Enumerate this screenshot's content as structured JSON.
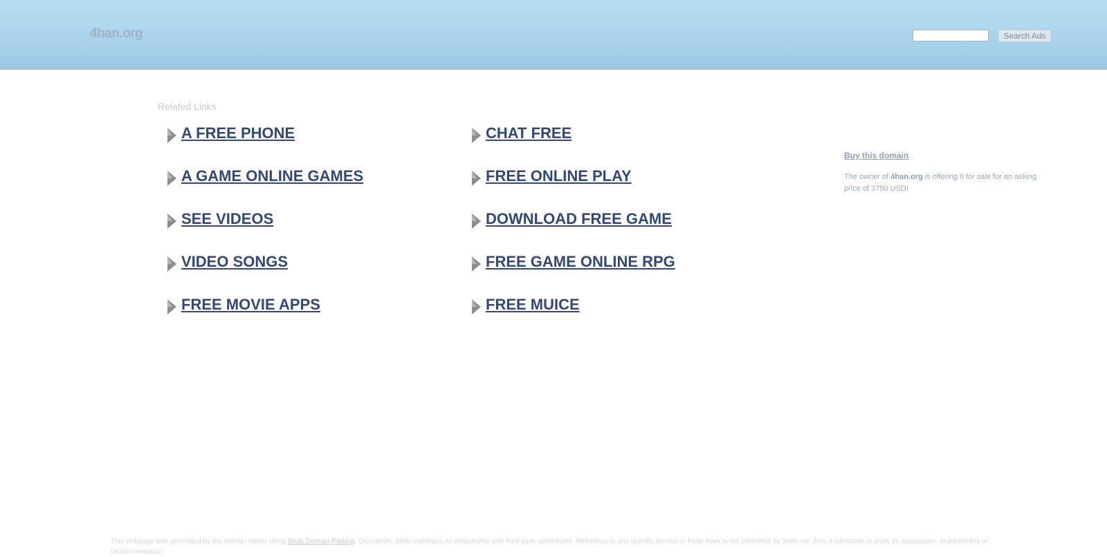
{
  "header": {
    "site_title": "4han.org",
    "search": {
      "placeholder": "",
      "value": ""
    },
    "search_button_label": "Search Ads"
  },
  "related": {
    "title": "Related Links",
    "left_links": [
      "A FREE PHONE",
      "A GAME ONLINE GAMES",
      "SEE VIDEOS",
      "VIDEO SONGS",
      "FREE MOVIE APPS"
    ],
    "right_links": [
      "CHAT FREE",
      "FREE ONLINE PLAY",
      "DOWNLOAD FREE GAME",
      "FREE GAME ONLINE RPG",
      "FREE MUICE"
    ]
  },
  "sidebar": {
    "buy_label": "Buy this domain",
    "owner_prefix": "The owner of ",
    "owner_domain": "4han.org",
    "owner_suffix": " is offering it for sale for an asking price of 3750 USD!"
  },
  "footer": {
    "prefix": "This webpage was generated by the domain owner using ",
    "link": "Sedo Domain Parking",
    "suffix": ". Disclaimer: Sedo maintains no relationship with third party advertisers. Reference to any specific service or trade mark is not controlled by Sedo nor does it constitute or imply its association, endorsement or recommendation."
  },
  "colors": {
    "header_bg": "#b8def1",
    "link": "#33487a",
    "sidebar_link": "#8aa1b8"
  },
  "icons": {
    "link_bullet": "arrow-icon"
  }
}
